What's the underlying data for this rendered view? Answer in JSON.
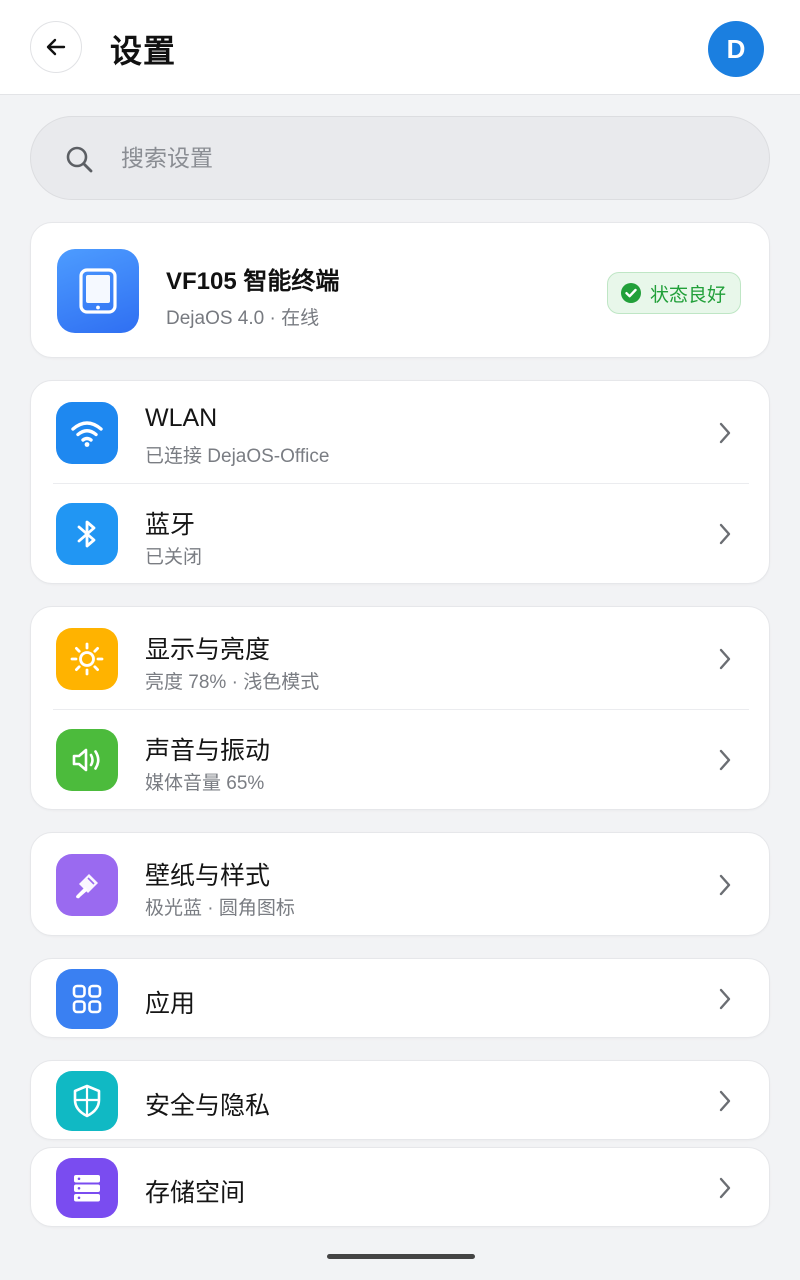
{
  "header": {
    "title": "设置",
    "avatar_letter": "D"
  },
  "search": {
    "placeholder": "搜索设置",
    "value": ""
  },
  "device": {
    "name": "VF105 智能终端",
    "subtitle": "DejaOS 4.0 · 在线",
    "status": "状态良好"
  },
  "groups": [
    {
      "items": [
        {
          "title": "WLAN",
          "subtitle": "已连接 DejaOS-Office",
          "icon": "wifi-icon",
          "color": "#1e88f0"
        },
        {
          "title": "蓝牙",
          "subtitle": "已关闭",
          "icon": "bluetooth-icon",
          "color": "#2196f3"
        }
      ]
    },
    {
      "items": [
        {
          "title": "显示与亮度",
          "subtitle": "亮度 78% · 浅色模式",
          "icon": "sun-icon",
          "color": "#ffb300"
        },
        {
          "title": "声音与振动",
          "subtitle": "媒体音量 65%",
          "icon": "speaker-icon",
          "color": "#4cbb3c"
        }
      ]
    },
    {
      "items": [
        {
          "title": "壁纸与样式",
          "subtitle": "极光蓝 · 圆角图标",
          "icon": "brush-icon",
          "color": "#9a6af0"
        }
      ]
    },
    {
      "items": [
        {
          "title": "应用",
          "subtitle": "",
          "icon": "apps-grid-icon",
          "color": "#3a80f2"
        }
      ]
    },
    {
      "items": [
        {
          "title": "安全与隐私",
          "subtitle": "",
          "icon": "shield-icon",
          "color": "#10b9c4"
        }
      ]
    },
    {
      "items": [
        {
          "title": "存储空间",
          "subtitle": "",
          "icon": "storage-icon",
          "color": "#7a4cf0"
        }
      ]
    }
  ],
  "colors": {
    "accent": "#1b7fe0",
    "status_green": "#22a03a",
    "background": "#f2f3f5"
  }
}
